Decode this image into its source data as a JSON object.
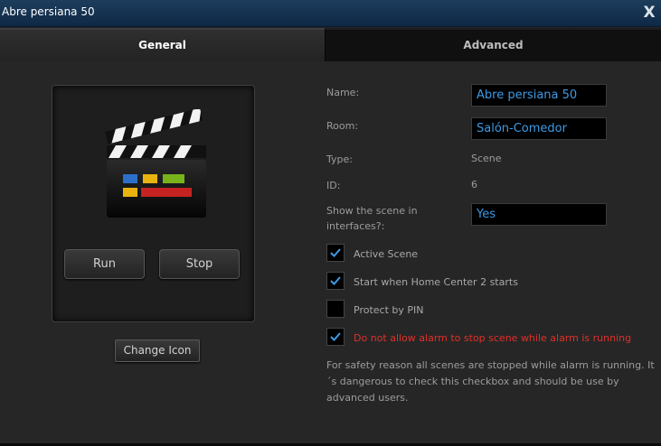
{
  "window": {
    "title": "Abre persiana 50",
    "close_label": "X"
  },
  "tabs": [
    {
      "label": "General",
      "active": true
    },
    {
      "label": "Advanced",
      "active": false
    }
  ],
  "general": {
    "icon": "clapperboard-icon",
    "run_label": "Run",
    "stop_label": "Stop",
    "change_icon_label": "Change Icon"
  },
  "details": {
    "name_label": "Name:",
    "name_value": "Abre persiana 50",
    "room_label": "Room:",
    "room_value": "Salón-Comedor",
    "type_label": "Type:",
    "type_value": "Scene",
    "id_label": "ID:",
    "id_value": "6",
    "show_label": "Show the scene in interfaces?:",
    "show_value": "Yes"
  },
  "options": [
    {
      "label": "Active Scene",
      "checked": true,
      "warning": false
    },
    {
      "label": "Start when Home Center 2 starts",
      "checked": true,
      "warning": false
    },
    {
      "label": "Protect by PIN",
      "checked": false,
      "warning": false
    },
    {
      "label": "Do not allow alarm to stop scene while alarm is running",
      "checked": true,
      "warning": true
    }
  ],
  "note": "For safety reason all scenes are stopped while alarm is running. It´s dangerous to check this checkbox and should be use by advanced users.",
  "colors": {
    "accent_text": "#3e9ae4",
    "warning_text": "#e0302a",
    "titlebar": "#163654"
  }
}
